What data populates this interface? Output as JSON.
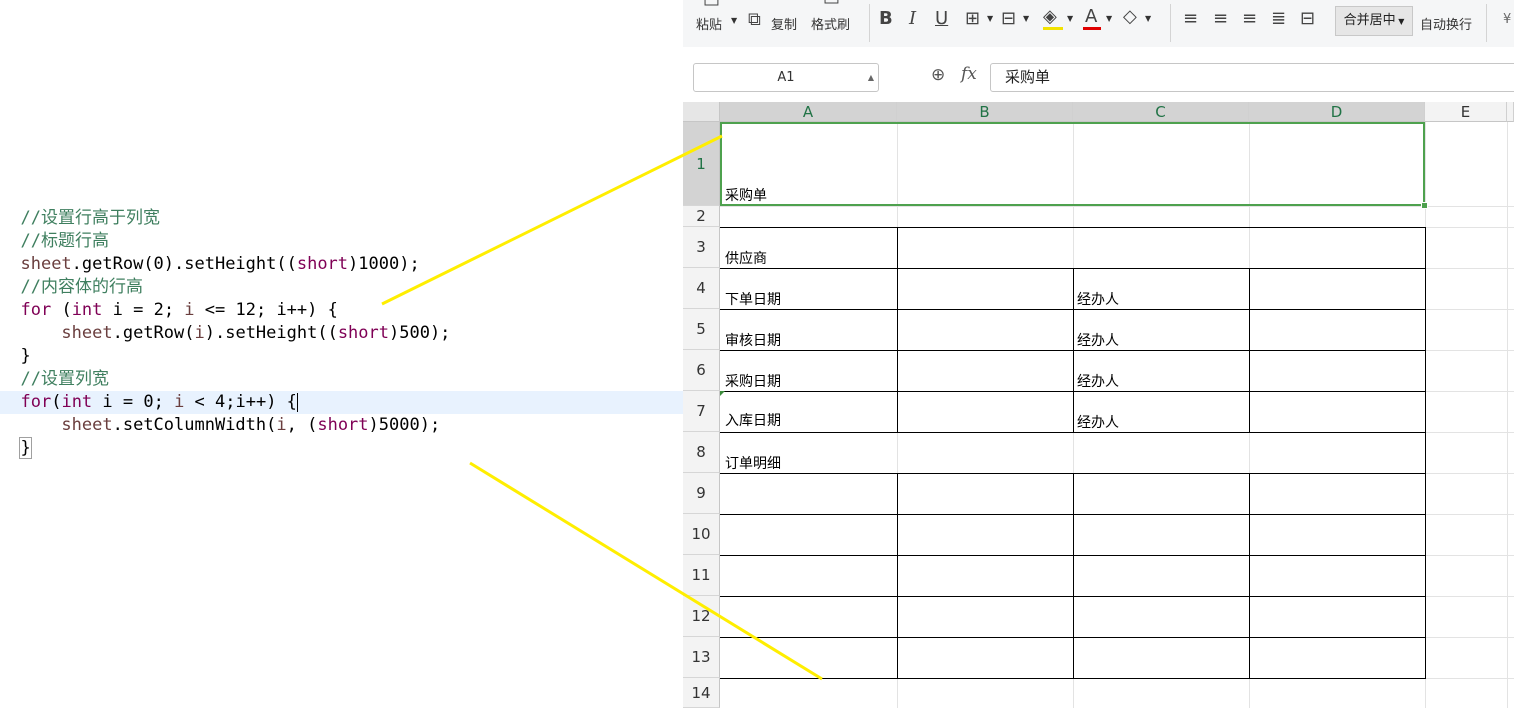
{
  "editor": {
    "lines": [
      {
        "text": "//设置行高于列宽",
        "kind": "comment"
      },
      {
        "text": "//标题行高",
        "kind": "comment"
      },
      {
        "text": "//内容体的行高",
        "kind": "comment"
      },
      {
        "text": "//设置列宽",
        "kind": "comment"
      }
    ],
    "tokens": {
      "sheet": "sheet",
      "getRow0": ".getRow(0).setHeight((",
      "short": "short",
      "h1000": ")1000);",
      "for": "for",
      "space_paren": " (",
      "int": "int",
      "i_eq_2": " i = 2; ",
      "i": "i",
      "le12": " <= 12; ",
      "ipp_brace": "i++) {",
      "getRow_i_open": ".getRow(",
      "setHeight_open": ").setHeight((",
      "h500": ")500);",
      "close_brace": "}",
      "for_paren": "(",
      "i_eq_0": " i = 0; ",
      "lt4": " < 4;",
      "ipp_brace2": "i++) {",
      "setColumnWidth_open": ".setColumnWidth(",
      "comma_paren": ", (",
      "w5000": ")5000);",
      "open_brace": "{"
    }
  },
  "ribbon": {
    "paste": "粘贴",
    "copy": "复制",
    "format_painter": "格式刷",
    "bold": "B",
    "italic": "I",
    "underline": "U",
    "font_color_letter": "A",
    "merge_center": "合并居中",
    "wrap_text": "自动换行",
    "cut_off": "¥"
  },
  "formula_bar": {
    "name_box": "A1",
    "fx_label": "fx",
    "formula_value": "采购单"
  },
  "grid": {
    "columns": [
      "A",
      "B",
      "C",
      "D",
      "E"
    ],
    "rows": [
      "1",
      "2",
      "3",
      "4",
      "5",
      "6",
      "7",
      "8",
      "9",
      "10",
      "11",
      "12",
      "13",
      "14"
    ],
    "cells": {
      "A1": "采购单",
      "A3": "供应商",
      "A4": "下单日期",
      "C4": "经办人",
      "A5": "审核日期",
      "C5": "经办人",
      "A6": "采购日期",
      "C6": "经办人",
      "A7": "入库日期",
      "C7": "经办人",
      "A8": "订单明细"
    }
  },
  "colors": {
    "comment": "#3f7f5f",
    "keyword": "#7f0055",
    "variable": "#6a3e3e",
    "selection_green": "#4ea14e",
    "annotation_yellow": "#ffee00"
  }
}
